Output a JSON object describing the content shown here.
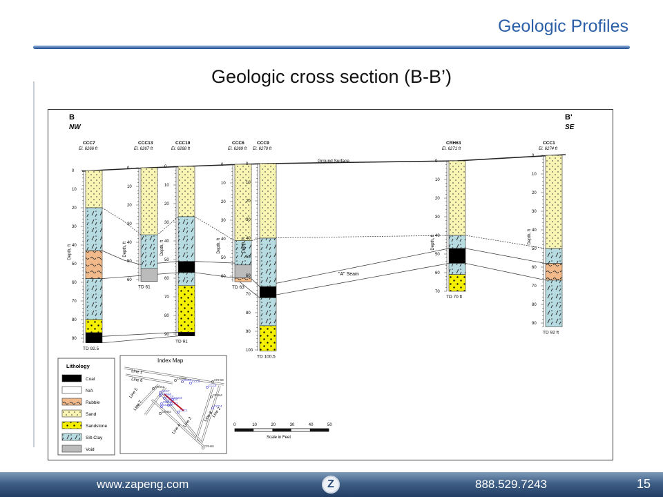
{
  "header": {
    "title": "Geologic Profiles"
  },
  "slide": {
    "subtitle": "Geologic cross section (B-B’)"
  },
  "section": {
    "left_end": "B",
    "left_dir": "NW",
    "right_end": "B'",
    "right_dir": "SE",
    "ground_label": "Ground Surface",
    "seam_label": "\"A\" Seam",
    "depth_axis_label": "Depth, ft"
  },
  "borings": [
    {
      "id": "CCC7",
      "elev": "El. 6266 ft",
      "td": "TD 92.5",
      "total": 92.5,
      "layers": [
        [
          "sand",
          0,
          20
        ],
        [
          "siltclay",
          20,
          43
        ],
        [
          "rubble",
          43,
          58
        ],
        [
          "siltclay",
          58,
          80
        ],
        [
          "sandstone",
          80,
          87
        ],
        [
          "coal",
          87,
          92.5
        ]
      ]
    },
    {
      "id": "CCC13",
      "elev": "El. 6267 ft",
      "td": "TD 61",
      "total": 61,
      "layers": [
        [
          "sand",
          0,
          36
        ],
        [
          "siltclay",
          36,
          54
        ],
        [
          "void",
          54,
          61
        ]
      ]
    },
    {
      "id": "CCC10",
      "elev": "El. 6268 ft",
      "td": "TD 91",
      "total": 91,
      "layers": [
        [
          "sand",
          0,
          27
        ],
        [
          "siltclay",
          27,
          51
        ],
        [
          "coal",
          51,
          57
        ],
        [
          "siltclay",
          57,
          64
        ],
        [
          "sandstone",
          64,
          89
        ],
        [
          "coal",
          89,
          91
        ]
      ]
    },
    {
      "id": "CCC6",
      "elev": "El. 6269 ft",
      "td": "TD 63",
      "total": 63,
      "layers": [
        [
          "sand",
          0,
          41
        ],
        [
          "siltclay",
          41,
          54
        ],
        [
          "void",
          54,
          61
        ],
        [
          "rubble",
          61,
          63
        ]
      ]
    },
    {
      "id": "CCC9",
      "elev": "El. 6270 ft",
      "td": "TD 100.5",
      "total": 100.5,
      "layers": [
        [
          "sand",
          0,
          40
        ],
        [
          "siltclay",
          40,
          66
        ],
        [
          "coal",
          66,
          72
        ],
        [
          "siltclay",
          72,
          87
        ],
        [
          "sandstone",
          87,
          100.5
        ]
      ]
    },
    {
      "id": "CRH63",
      "elev": "El. 6271 ft",
      "td": "TD 70 ft",
      "total": 70,
      "layers": [
        [
          "sand",
          0,
          40
        ],
        [
          "siltclay",
          40,
          47
        ],
        [
          "coal",
          47,
          55
        ],
        [
          "siltclay",
          55,
          61
        ],
        [
          "sandstone",
          61,
          70
        ]
      ]
    },
    {
      "id": "CCC1",
      "elev": "El. 6274 ft",
      "td": "TD 92 ft",
      "total": 92,
      "layers": [
        [
          "sand",
          0,
          50
        ],
        [
          "siltclay",
          50,
          58
        ],
        [
          "rubble",
          58,
          67
        ],
        [
          "siltclay",
          67,
          92
        ]
      ]
    }
  ],
  "legend": {
    "title": "Lithology",
    "items": [
      {
        "key": "coal",
        "label": "Coal"
      },
      {
        "key": "na",
        "label": "N/A"
      },
      {
        "key": "rubble",
        "label": "Rubble"
      },
      {
        "key": "sand",
        "label": "Sand"
      },
      {
        "key": "sandstone",
        "label": "Sandstone"
      },
      {
        "key": "siltclay",
        "label": "Silt-Clay"
      },
      {
        "key": "void",
        "label": "Void"
      }
    ]
  },
  "index_map": {
    "title": "Index Map",
    "line_labels": [
      "Line 1",
      "Line 6",
      "Line 5",
      "Line 7",
      "Line 3",
      "Line 4",
      "Line 8",
      "Line 2"
    ],
    "points": [
      "CRH62",
      "CCC9",
      "CCC8",
      "CRH59",
      "CRH61",
      "CCC7",
      "CCC13",
      "CCC5",
      "CCC6",
      "CCC10",
      "CCC3",
      "CRH64",
      "CCC11",
      "CCC12",
      "CCC2",
      "CRH63",
      "CCC1",
      "CCC4",
      "CRH65"
    ]
  },
  "scale": {
    "ticks": [
      "0",
      "10",
      "20",
      "30",
      "40",
      "50"
    ],
    "label": "Scale in Feet"
  },
  "footer": {
    "url": "www.zapeng.com",
    "logo": "Z",
    "phone": "888.529.7243",
    "page": "15"
  },
  "colors": {
    "sand": "#f7f4b4",
    "sandstone": "#f5f000",
    "siltclay": "#b6dbe0",
    "rubble": "#f2ba8a",
    "coal": "#000000",
    "void": "#bbbbbb",
    "na": "#ffffff",
    "accent": "#2a5fa8"
  }
}
